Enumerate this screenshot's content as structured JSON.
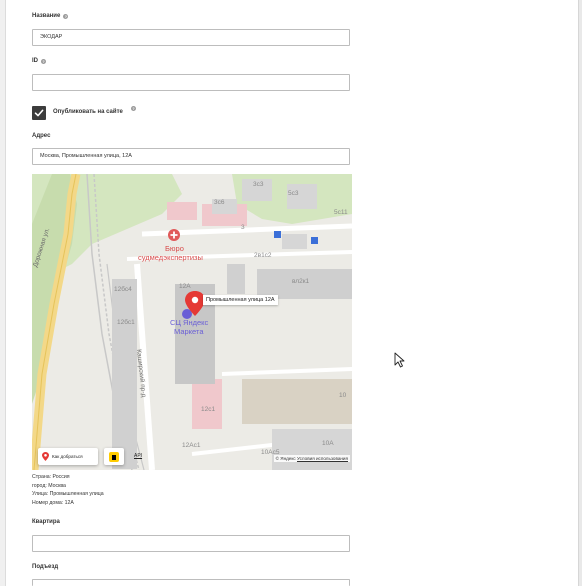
{
  "form": {
    "name_label": "Название",
    "name_value": "ЭКОДАР",
    "id_label": "ID",
    "id_value": "",
    "publish_label": "Опубликовать на сайте",
    "address_label": "Адрес",
    "address_value": "Москва, Промышленная улица, 12А",
    "apartment_label": "Квартира",
    "apartment_value": "",
    "entrance_label": "Подъезд"
  },
  "map": {
    "street_road": "Дорожная ул.",
    "street_kashirsky": "Каширский пр-д",
    "poi_bureau_line1": "Бюро",
    "poi_bureau_line2": "судмедэкспертизы",
    "poi_sc_line1": "СЦ Яндекс",
    "poi_sc_line2": "Маркета",
    "pin_label": "Промышленная улица 12А",
    "route_button": "Как добраться",
    "api_link": "API",
    "copyright": "© Яндекс",
    "terms_link": "Условия использования",
    "bus_stop": "A",
    "buildings": {
      "b3c3": "3с3",
      "b5c3": "5с3",
      "b5c11": "5с11",
      "b3c6": "3с6",
      "b3": "3",
      "b2v1c2": "2в1с2",
      "b2v2c1": "вл2к1",
      "b12a": "12А",
      "b12bc4": "12бс4",
      "b12bc1": "12бс1",
      "b12c1": "12с1",
      "b10": "10",
      "b12ac1": "12Ас1",
      "b10a": "10А",
      "b10ac5": "10Ас5"
    },
    "colors": {
      "pin": "#e53935",
      "poi_red": "#e05a5a",
      "poi_blue": "#6a5fd6",
      "park": "#cfe3b6"
    }
  },
  "address_details": {
    "country": "Страна: Россия",
    "city": "город: Москва",
    "street": "Улица: Промышленная улица",
    "house": "Номер дома: 12А"
  }
}
